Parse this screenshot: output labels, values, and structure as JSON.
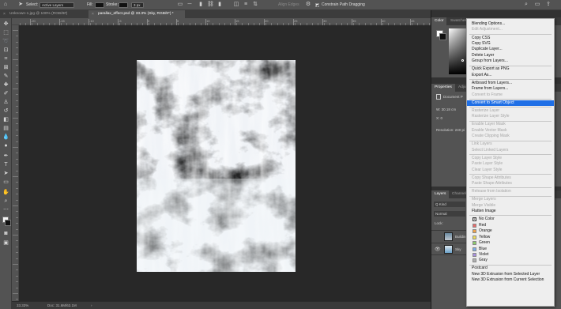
{
  "options_bar": {
    "select_label": "Select:",
    "select_value": "Active Layers",
    "fill_label": "Fill:",
    "stroke_label": "Stroke:",
    "stroke_value": "3 px",
    "align_edges_label": "Align Edges",
    "constrain_label": "Constrain Path Dragging"
  },
  "tabs": [
    {
      "label": "Unknown-1.jpg @ 100% (RGB/8#)"
    },
    {
      "label": "parallax_effect.psd @ 33.3% (Sky, RGB/8*) *"
    }
  ],
  "ruler": {
    "top_ticks": [
      "-20",
      "-15",
      "-10",
      "-5",
      "0",
      "5",
      "10",
      "15",
      "20",
      "25",
      "30",
      "35",
      "40",
      "45"
    ]
  },
  "status_bar": {
    "zoom": "33.33%",
    "doc": "Doc: 31.6M/63.1M"
  },
  "color_panel": {
    "tabs": [
      "Color",
      "Swatches"
    ]
  },
  "properties_panel": {
    "tabs": [
      "Properties",
      "Adjustments"
    ],
    "doc_label": "Document P",
    "w_label": "W: 30.18 cm",
    "x_label": "X: 0",
    "resolution_label": "Resolution: 240 pi"
  },
  "layers_panel": {
    "tabs": [
      "Layers",
      "Channels"
    ],
    "kind_label": "Q Kind",
    "blend_mode": "Normal",
    "lock_label": "Lock:",
    "layers": [
      {
        "name": "Buildin",
        "visible": false
      },
      {
        "name": "Sky",
        "visible": true
      }
    ]
  },
  "context_menu": {
    "items": [
      {
        "label": "Blending Options...",
        "enabled": true
      },
      {
        "label": "Edit Adjustment...",
        "enabled": false
      },
      {
        "sep": true
      },
      {
        "label": "Copy CSS",
        "enabled": true
      },
      {
        "label": "Copy SVG",
        "enabled": true
      },
      {
        "label": "Duplicate Layer...",
        "enabled": true
      },
      {
        "label": "Delete Layer",
        "enabled": true
      },
      {
        "label": "Group from Layers...",
        "enabled": true
      },
      {
        "sep": true
      },
      {
        "label": "Quick Export as PNG",
        "enabled": true
      },
      {
        "label": "Export As...",
        "enabled": true
      },
      {
        "sep": true
      },
      {
        "label": "Artboard from Layers...",
        "enabled": true
      },
      {
        "label": "Frame from Layers...",
        "enabled": true
      },
      {
        "label": "Convert to Frame",
        "enabled": false
      },
      {
        "sep": true
      },
      {
        "label": "Convert to Smart Object",
        "enabled": true,
        "highlight": true
      },
      {
        "sep": true
      },
      {
        "label": "Rasterize Layer",
        "enabled": false
      },
      {
        "label": "Rasterize Layer Style",
        "enabled": false
      },
      {
        "sep": true
      },
      {
        "label": "Enable Layer Mask",
        "enabled": false
      },
      {
        "label": "Enable Vector Mask",
        "enabled": false
      },
      {
        "label": "Create Clipping Mask",
        "enabled": false
      },
      {
        "sep": true
      },
      {
        "label": "Link Layers",
        "enabled": false
      },
      {
        "label": "Select Linked Layers",
        "enabled": false
      },
      {
        "sep": true
      },
      {
        "label": "Copy Layer Style",
        "enabled": false
      },
      {
        "label": "Paste Layer Style",
        "enabled": false
      },
      {
        "label": "Clear Layer Style",
        "enabled": false
      },
      {
        "sep": true
      },
      {
        "label": "Copy Shape Attributes",
        "enabled": false
      },
      {
        "label": "Paste Shape Attributes",
        "enabled": false
      },
      {
        "sep": true
      },
      {
        "label": "Release from Isolation",
        "enabled": false
      },
      {
        "sep": true
      },
      {
        "label": "Merge Layers",
        "enabled": false
      },
      {
        "label": "Merge Visible",
        "enabled": false
      },
      {
        "label": "Flatten Image",
        "enabled": true
      },
      {
        "sep": true
      },
      {
        "label": "No Color",
        "enabled": true,
        "color": "none"
      },
      {
        "label": "Red",
        "enabled": true,
        "color": "#e86a6a"
      },
      {
        "label": "Orange",
        "enabled": true,
        "color": "#f0a24a"
      },
      {
        "label": "Yellow",
        "enabled": true,
        "color": "#eedc5a"
      },
      {
        "label": "Green",
        "enabled": true,
        "color": "#8ccc6a"
      },
      {
        "label": "Blue",
        "enabled": true,
        "color": "#7aaee8"
      },
      {
        "label": "Violet",
        "enabled": true,
        "color": "#a890e0"
      },
      {
        "label": "Gray",
        "enabled": true,
        "color": "#b0b0b0"
      },
      {
        "sep": true
      },
      {
        "label": "Postcard",
        "enabled": true
      },
      {
        "label": "New 3D Extrusion from Selected Layer",
        "enabled": true
      },
      {
        "label": "New 3D Extrusion from Current Selection",
        "enabled": true
      }
    ]
  },
  "colors": {
    "menu_highlight": "#1f6fe6",
    "sky_blue": "#3f8fbd",
    "cloud_white": "#eef2f6"
  }
}
